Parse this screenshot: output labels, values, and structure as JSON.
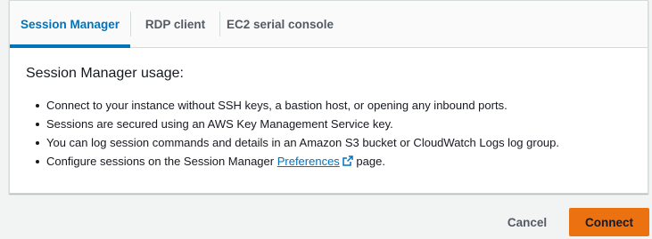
{
  "tabs": [
    {
      "label": "Session Manager",
      "active": true
    },
    {
      "label": "RDP client",
      "active": false
    },
    {
      "label": "EC2 serial console",
      "active": false
    }
  ],
  "usage": {
    "title": "Session Manager usage:",
    "bullets": [
      "Connect to your instance without SSH keys, a bastion host, or opening any inbound ports.",
      "Sessions are secured using an AWS Key Management Service key.",
      "You can log session commands and details in an Amazon S3 bucket or CloudWatch Logs log group."
    ],
    "configure": {
      "before": "Configure sessions on the Session Manager ",
      "link": "Preferences",
      "after": " page."
    }
  },
  "footer": {
    "cancel_label": "Cancel",
    "connect_label": "Connect"
  },
  "colors": {
    "accent": "#0073bb",
    "primary_button": "#ec7211"
  },
  "icons": {
    "external_link": "external-link-icon"
  }
}
